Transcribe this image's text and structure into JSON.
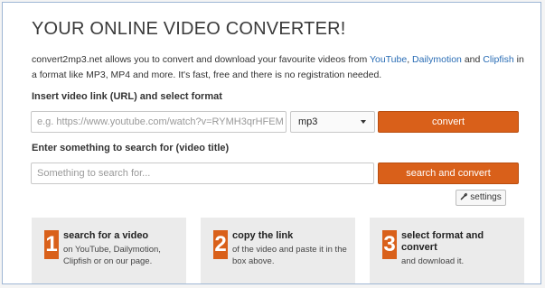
{
  "title": "YOUR ONLINE VIDEO CONVERTER!",
  "intro": {
    "part1": "convert2mp3.net allows you to convert and download your favourite videos from ",
    "link_youtube": "YouTube",
    "sep": ", ",
    "link_dailymotion": "Dailymotion",
    "and": " and ",
    "link_clipfish": "Clipfish",
    "part2": " in a format like MP3, MP4 and more. It's fast, free and there is no registration needed."
  },
  "convert_form": {
    "label": "Insert video link (URL) and select format",
    "url_placeholder": "e.g. https://www.youtube.com/watch?v=RYMH3qrHFEM",
    "format_selected": "mp3",
    "convert_label": "convert"
  },
  "search_form": {
    "label": "Enter something to search for (video title)",
    "placeholder": "Something to search for...",
    "button_label": "search and convert"
  },
  "settings": {
    "label": "settings",
    "icon": "wrench-icon"
  },
  "steps": [
    {
      "number": "1",
      "title": "search for a video",
      "desc": "on YouTube, Dailymotion, Clipfish or on our page."
    },
    {
      "number": "2",
      "title": "copy the link",
      "desc": "of the video and paste it in the box above."
    },
    {
      "number": "3",
      "title": "select format and convert",
      "desc": "and download it."
    }
  ],
  "colors": {
    "accent": "#d9601a",
    "link": "#2a6db5",
    "step_bg": "#ebebeb"
  }
}
